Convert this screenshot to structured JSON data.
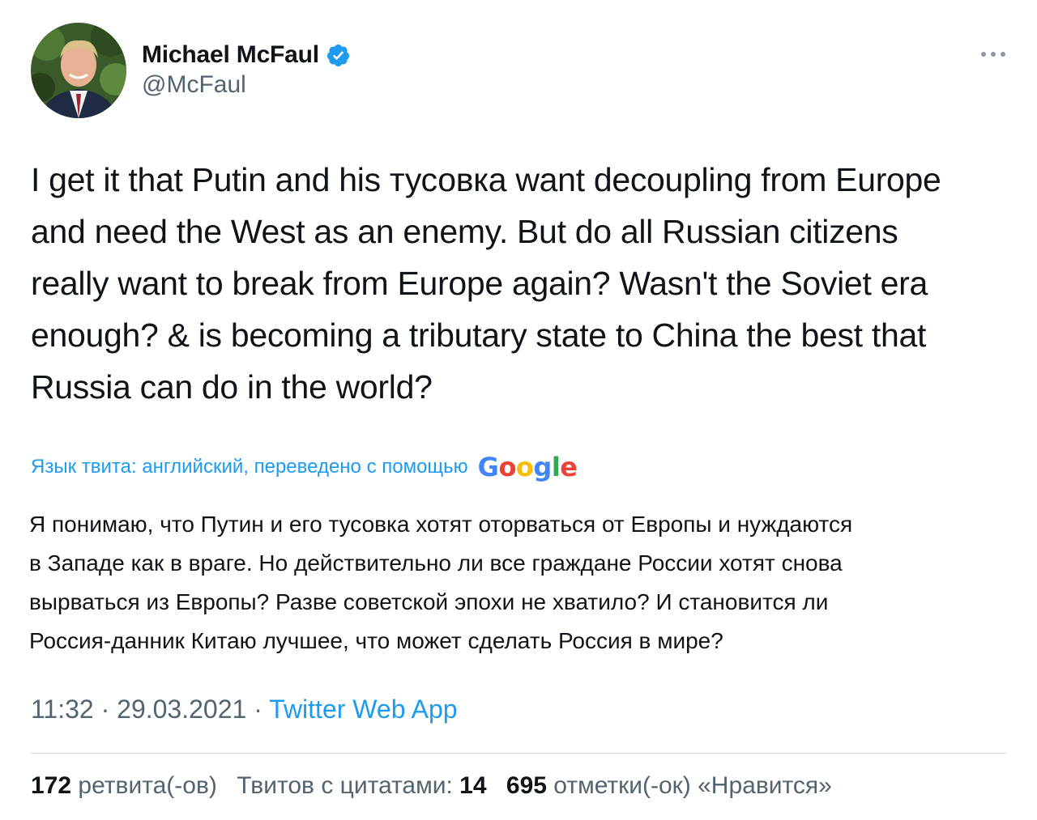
{
  "author": {
    "display_name": "Michael McFaul",
    "handle": "@McFaul",
    "verified": true
  },
  "tweet": {
    "text_lines": [
      "I get it that Putin and his тусовка want decoupling from Europe",
      "and need the West as an enemy. But do all Russian citizens",
      "really want to break from Europe again? Wasn't the  Soviet era",
      "enough? & is becoming a tributary state to China the best that",
      "Russia can do in the world?"
    ]
  },
  "translation": {
    "note": "Язык твита: английский, переведено с помощью",
    "provider": "Google",
    "text_lines": [
      "Я понимаю, что Путин и его тусовка хотят оторваться от Европы и нуждаются",
      "в Западе как в враге. Но действительно ли все граждане России хотят снова",
      "вырваться из Европы? Разве советской эпохи не хватило? И становится ли",
      "Россия-данник Китаю лучшее, что может сделать Россия в мире?"
    ]
  },
  "meta": {
    "time": "11:32",
    "separator": " · ",
    "date": "29.03.2021",
    "source": "Twitter Web App"
  },
  "stats": {
    "retweets_count": "172",
    "retweets_label": "ретвита(-ов)",
    "quotes_label": "Твитов с цитатами:",
    "quotes_count": "14",
    "likes_count": "695",
    "likes_label": "отметки(-ок) «Нравится»"
  },
  "colors": {
    "text": "#0f1419",
    "secondary": "#536471",
    "accent": "#1d9bf0",
    "divider": "#cfd9de"
  },
  "icons": {
    "verified": "verified-badge-icon",
    "more": "more-horizontal-icon"
  }
}
